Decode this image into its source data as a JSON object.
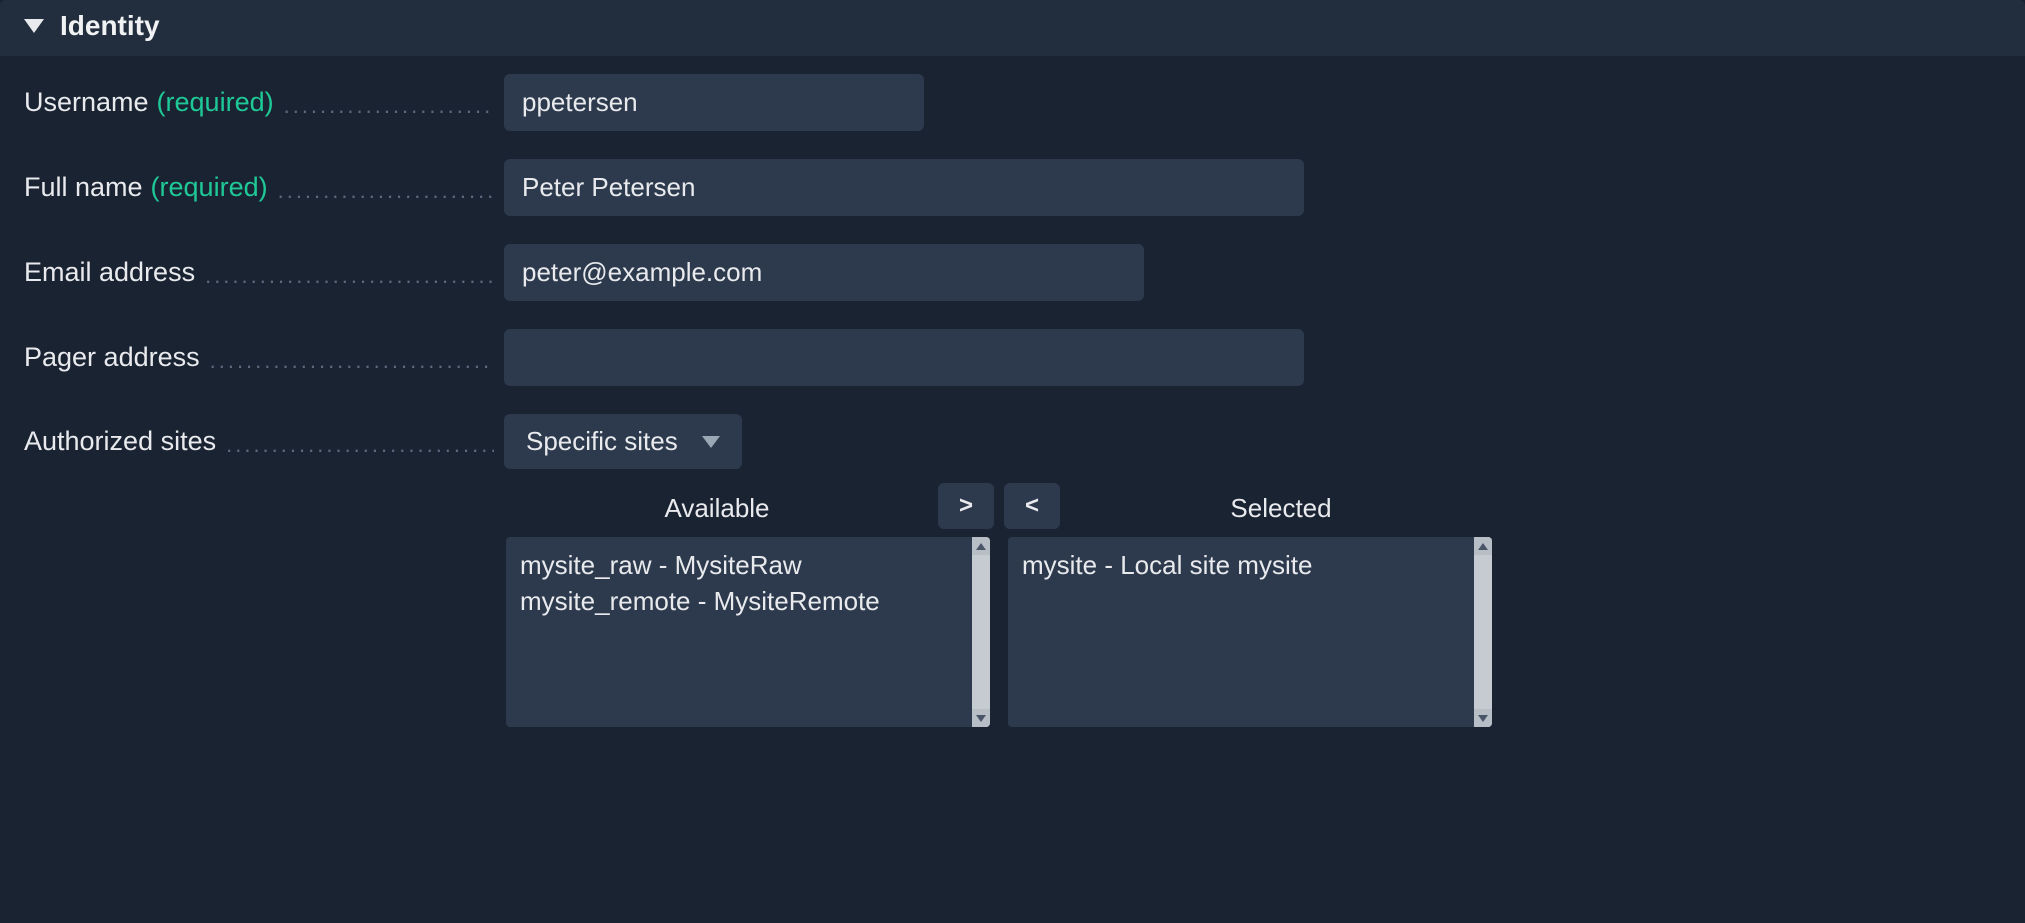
{
  "section": {
    "title": "Identity"
  },
  "labels": {
    "username": "Username",
    "fullname": "Full name",
    "email": "Email address",
    "pager": "Pager address",
    "authorized": "Authorized sites",
    "required": "(required)"
  },
  "values": {
    "username": "ppetersen",
    "fullname": "Peter Petersen",
    "email": "peter@example.com",
    "pager": "",
    "authorized_mode": "Specific sites"
  },
  "duallist": {
    "available_header": "Available",
    "selected_header": "Selected",
    "move_right": ">",
    "move_left": "<",
    "available": [
      "mysite_raw - MysiteRaw",
      "mysite_remote - MysiteRemote"
    ],
    "selected": [
      "mysite - Local site mysite"
    ]
  }
}
